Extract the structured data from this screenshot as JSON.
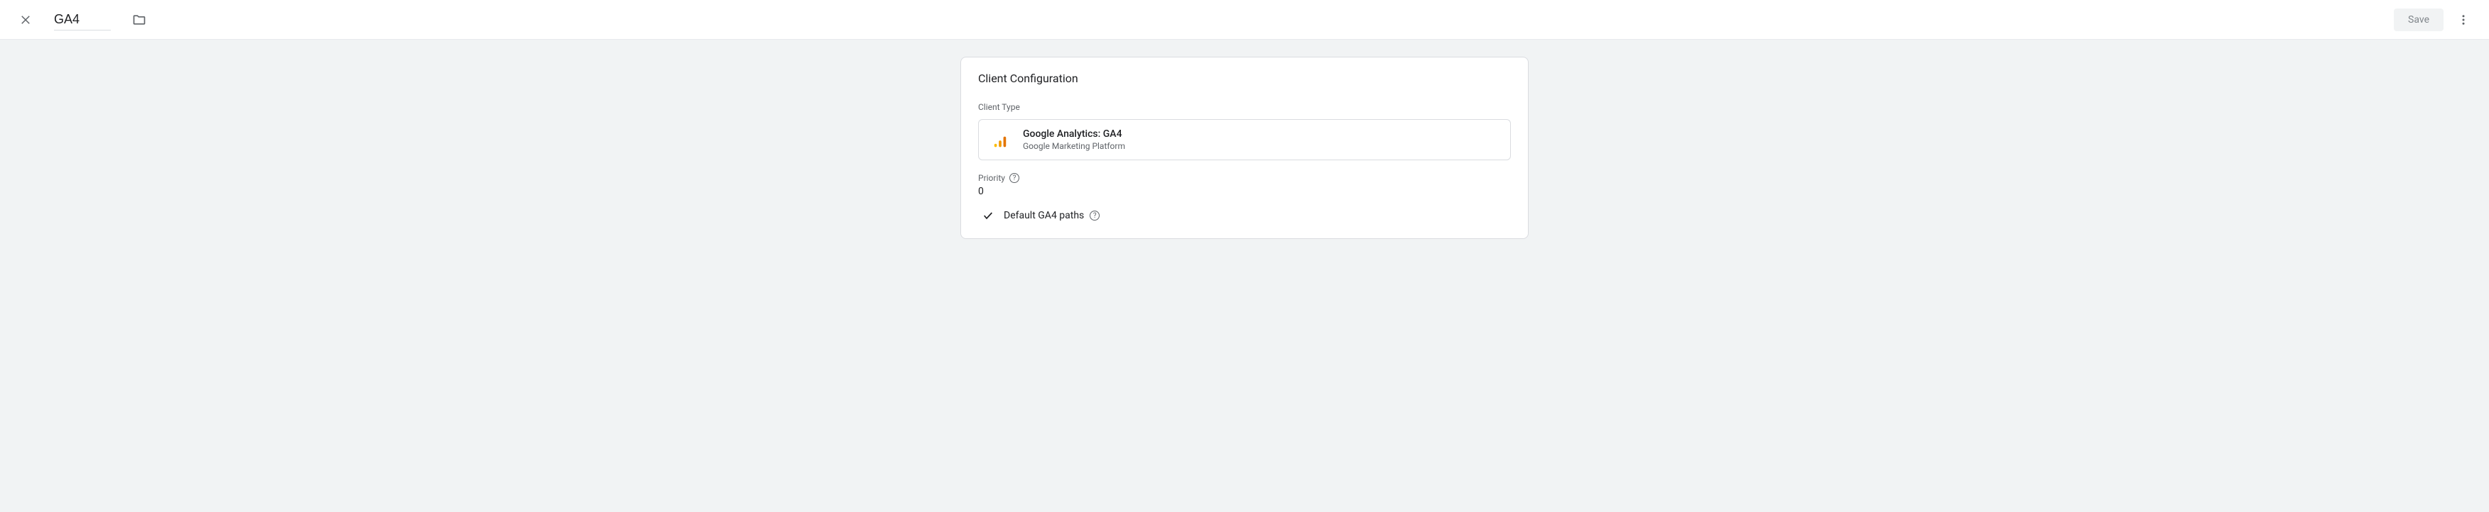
{
  "topbar": {
    "title_value": "GA4",
    "save_label": "Save"
  },
  "card": {
    "heading": "Client Configuration",
    "client_type_label": "Client Type",
    "client_type": {
      "name": "Google Analytics: GA4",
      "platform": "Google Marketing Platform"
    },
    "priority": {
      "label": "Priority",
      "value": "0"
    },
    "default_paths": {
      "label": "Default GA4 paths",
      "checked": true
    }
  }
}
